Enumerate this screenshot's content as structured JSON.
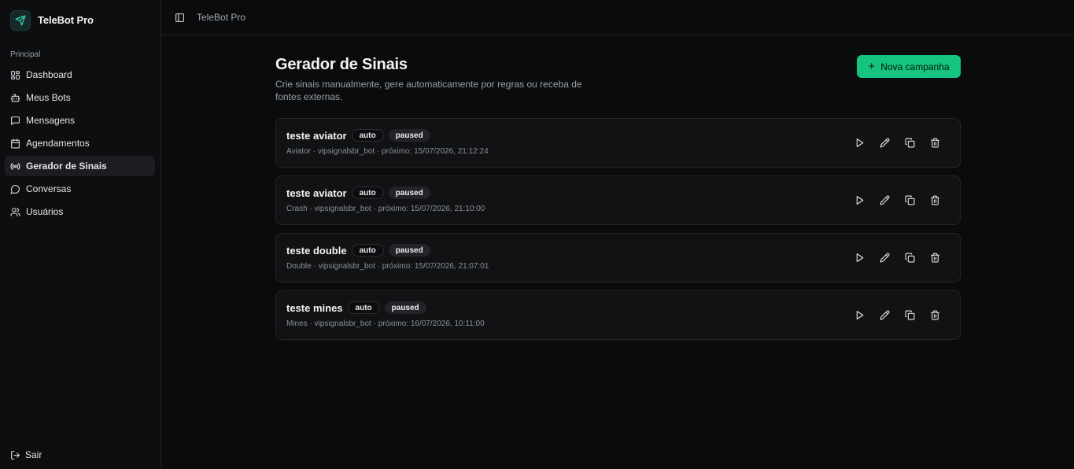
{
  "app": {
    "name": "TeleBot Pro"
  },
  "sidebar": {
    "section": "Principal",
    "items": [
      {
        "label": "Dashboard",
        "icon": "layout-grid-icon",
        "active": false
      },
      {
        "label": "Meus Bots",
        "icon": "bot-icon",
        "active": false
      },
      {
        "label": "Mensagens",
        "icon": "message-square-icon",
        "active": false
      },
      {
        "label": "Agendamentos",
        "icon": "calendar-icon",
        "active": false
      },
      {
        "label": "Gerador de Sinais",
        "icon": "radio-icon",
        "active": true
      },
      {
        "label": "Conversas",
        "icon": "message-circle-icon",
        "active": false
      },
      {
        "label": "Usuários",
        "icon": "users-icon",
        "active": false
      }
    ],
    "logout_label": "Sair"
  },
  "header": {
    "breadcrumb": "TeleBot Pro"
  },
  "main": {
    "title": "Gerador de Sinais",
    "subtitle": "Crie sinais manualmente, gere automaticamente por regras ou receba de fontes externas.",
    "new_button": "Nova campanha",
    "campaigns": [
      {
        "name": "teste aviator",
        "mode": "auto",
        "status": "paused",
        "meta": "Aviator · vipsignalsbr_bot · próximo: 15/07/2026, 21:12:24"
      },
      {
        "name": "teste aviator",
        "mode": "auto",
        "status": "paused",
        "meta": "Crash · vipsignalsbr_bot · próximo: 15/07/2026, 21:10:00"
      },
      {
        "name": "teste double",
        "mode": "auto",
        "status": "paused",
        "meta": "Double · vipsignalsbr_bot · próximo: 15/07/2026, 21:07:01"
      },
      {
        "name": "teste mines",
        "mode": "auto",
        "status": "paused",
        "meta": "Mines · vipsignalsbr_bot · próximo: 16/07/2026, 10:11:00"
      }
    ]
  },
  "colors": {
    "accent": "#15c47e",
    "background": "#0a0b0c",
    "card": "#111214"
  }
}
